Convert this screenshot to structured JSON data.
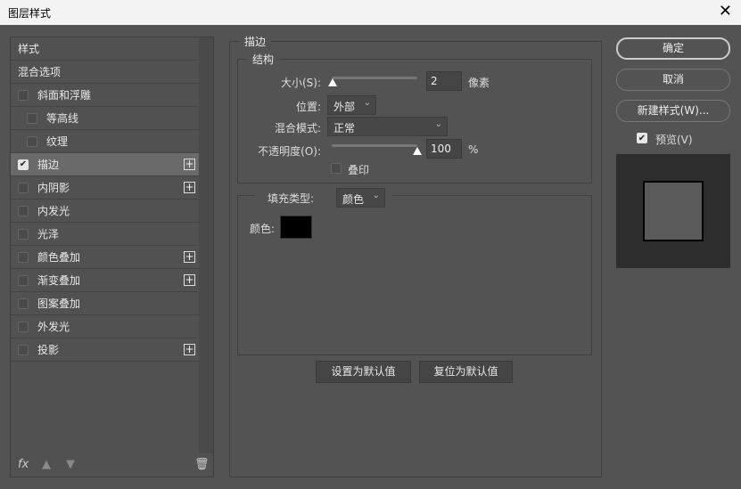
{
  "window": {
    "title": "图层样式",
    "close": "✕"
  },
  "sidebar": {
    "items": [
      {
        "label": "样式",
        "checkbox": false,
        "indent": 0,
        "plus": false
      },
      {
        "label": "混合选项",
        "checkbox": false,
        "indent": 0,
        "plus": false
      },
      {
        "label": "斜面和浮雕",
        "checkbox": true,
        "checked": false,
        "indent": 0,
        "plus": false
      },
      {
        "label": "等高线",
        "checkbox": true,
        "checked": false,
        "indent": 1,
        "plus": false
      },
      {
        "label": "纹理",
        "checkbox": true,
        "checked": false,
        "indent": 1,
        "plus": false
      },
      {
        "label": "描边",
        "checkbox": true,
        "checked": true,
        "indent": 0,
        "plus": true,
        "selected": true
      },
      {
        "label": "内阴影",
        "checkbox": true,
        "checked": false,
        "indent": 0,
        "plus": true
      },
      {
        "label": "内发光",
        "checkbox": true,
        "checked": false,
        "indent": 0,
        "plus": false
      },
      {
        "label": "光泽",
        "checkbox": true,
        "checked": false,
        "indent": 0,
        "plus": false
      },
      {
        "label": "颜色叠加",
        "checkbox": true,
        "checked": false,
        "indent": 0,
        "plus": true
      },
      {
        "label": "渐变叠加",
        "checkbox": true,
        "checked": false,
        "indent": 0,
        "plus": true
      },
      {
        "label": "图案叠加",
        "checkbox": true,
        "checked": false,
        "indent": 0,
        "plus": false
      },
      {
        "label": "外发光",
        "checkbox": true,
        "checked": false,
        "indent": 0,
        "plus": false
      },
      {
        "label": "投影",
        "checkbox": true,
        "checked": false,
        "indent": 0,
        "plus": true
      }
    ],
    "fx": "fx"
  },
  "stroke": {
    "title": "描边",
    "structure": "结构",
    "size_label": "大小(S):",
    "size_value": "2",
    "size_unit": "像素",
    "size_fraction": 0.01,
    "position_label": "位置:",
    "position_value": "外部",
    "blend_label": "混合模式:",
    "blend_value": "正常",
    "opacity_label": "不透明度(O):",
    "opacity_value": "100",
    "opacity_unit": "%",
    "opacity_fraction": 1.0,
    "overprint_label": "叠印",
    "fill_type_label": "填充类型:",
    "fill_type_value": "颜色",
    "color_label": "颜色:",
    "color": "#000000",
    "set_default": "设置为默认值",
    "reset_default": "复位为默认值"
  },
  "right": {
    "ok": "确定",
    "cancel": "取消",
    "new_style": "新建样式(W)...",
    "preview_label": "预览(V)",
    "preview_checked": true
  }
}
